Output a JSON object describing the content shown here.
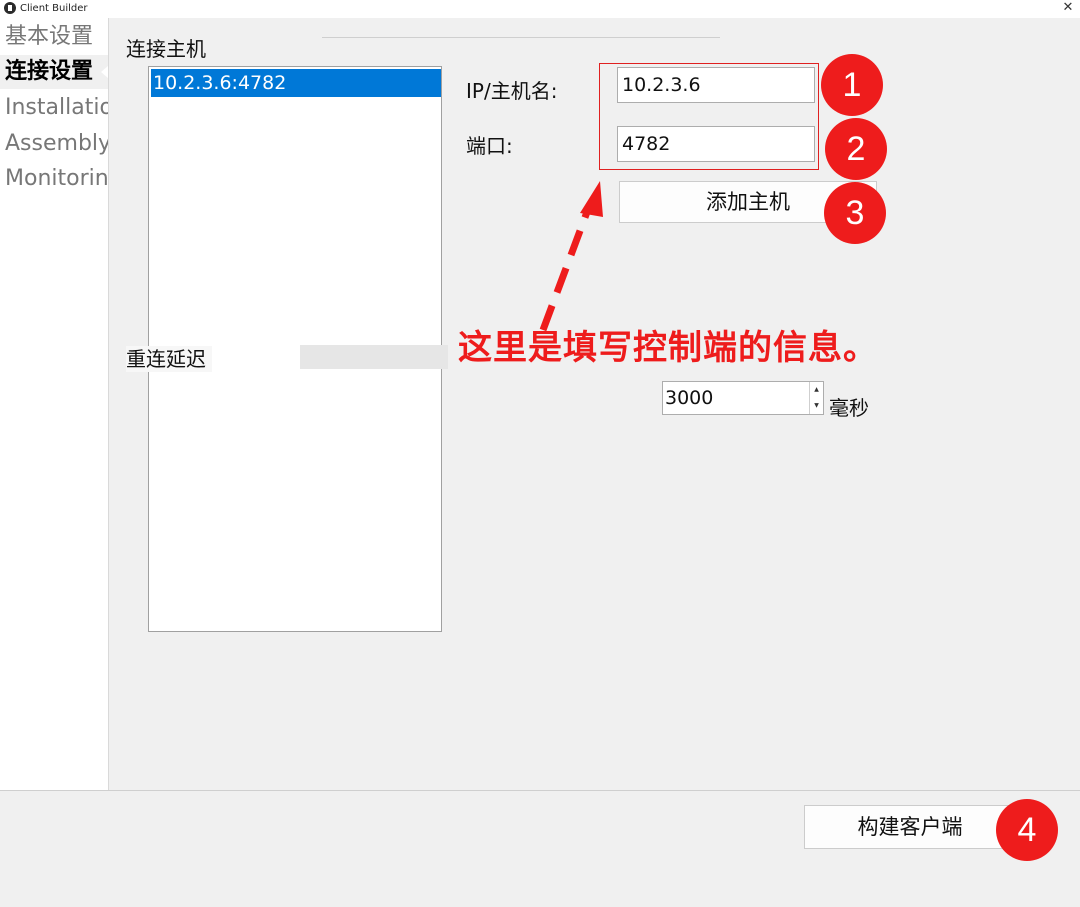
{
  "window": {
    "title": "Client Builder",
    "close_glyph": "✕"
  },
  "sidebar": {
    "items": [
      {
        "label": "基本设置"
      },
      {
        "label": "连接设置"
      },
      {
        "label": "Installatio"
      },
      {
        "label": "Assembly"
      },
      {
        "label": "Monitorin"
      }
    ]
  },
  "connection": {
    "section_title": "连接主机",
    "hosts": [
      "10.2.3.6:4782"
    ],
    "ip_label": "IP/主机名:",
    "ip_value": "10.2.3.6",
    "port_label": "端口:",
    "port_value": "4782",
    "add_host_label": "添加主机",
    "reconnect_label": "重连延迟",
    "delay_value": "3000",
    "delay_unit": "毫秒",
    "spin_up_glyph": "▲",
    "spin_down_glyph": "▼"
  },
  "footer": {
    "build_label": "构建客户端"
  },
  "annotations": {
    "note": "这里是填写控制端的信息。",
    "badges": [
      "1",
      "2",
      "3",
      "4"
    ],
    "color": "#ee1c1c"
  },
  "colors": {
    "selection": "#0078d7",
    "annotation_red": "#ee1c1c",
    "background": "#f0f0f0"
  }
}
